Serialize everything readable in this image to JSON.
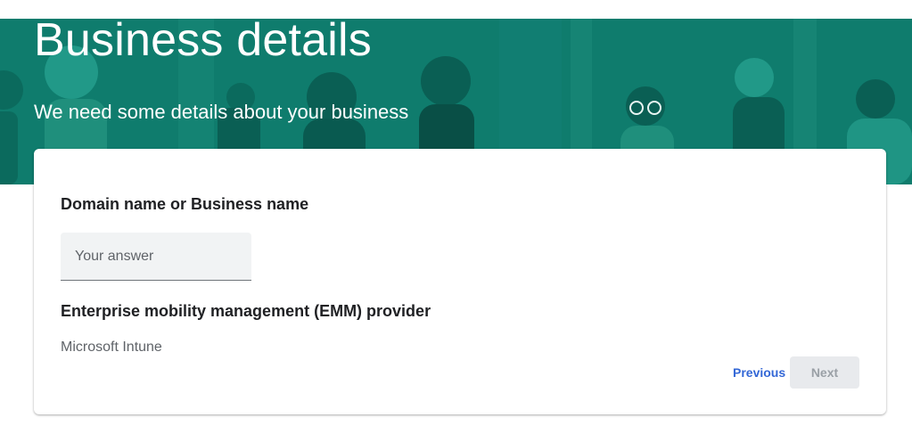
{
  "banner": {
    "title": "Business details",
    "subtitle": "We need some details about your business",
    "background_color": "#0f7c6d"
  },
  "form": {
    "question_1": {
      "label": "Domain name or Business name",
      "placeholder": "Your answer",
      "value": ""
    },
    "question_2": {
      "label": "Enterprise mobility management (EMM) provider",
      "value": "Microsoft Intune"
    },
    "navigation": {
      "previous_label": "Previous",
      "next_label": "Next",
      "next_enabled": false,
      "accent_color": "#3367d6"
    }
  }
}
